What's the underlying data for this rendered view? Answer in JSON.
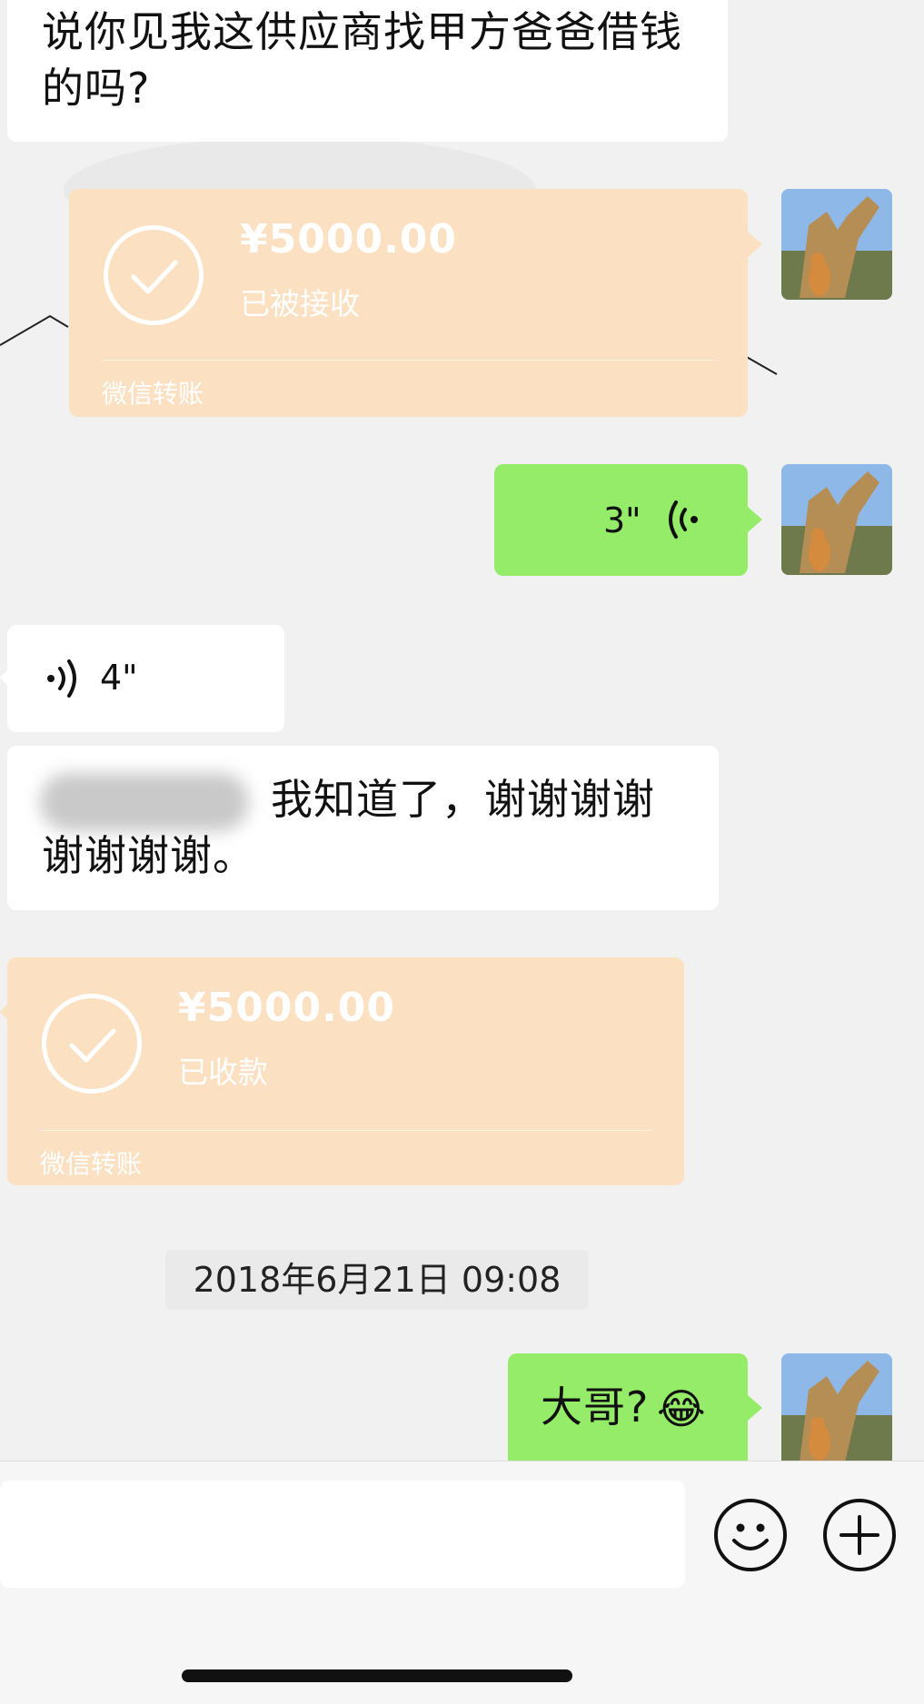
{
  "messages": {
    "m1_text": "说你见我这供应商找甲方爸爸借钱的吗?",
    "transfer1": {
      "amount": "¥5000.00",
      "status": "已被接收",
      "footer": "微信转账"
    },
    "voice_out": {
      "duration": "3\""
    },
    "voice_in": {
      "duration": "4\""
    },
    "m2_text": "我知道了，谢谢谢谢谢谢谢谢。",
    "transfer2": {
      "amount": "¥5000.00",
      "status": "已收款",
      "footer": "微信转账"
    },
    "timestamp": "2018年6月21日 09:08",
    "m3_text": "大哥?",
    "m3_emoji": "😂"
  },
  "colors": {
    "background": "#f1f1f1",
    "bubble_green": "#95ec69",
    "bubble_white": "#ffffff",
    "transfer_bubble": "#fbe0c2"
  },
  "icons": {
    "emoji_button": "emoji-face-icon",
    "more_button": "plus-circle-icon",
    "voice_out": "voice-wave-icon",
    "voice_in": "voice-wave-icon",
    "transfer_status": "check-circle-icon"
  }
}
